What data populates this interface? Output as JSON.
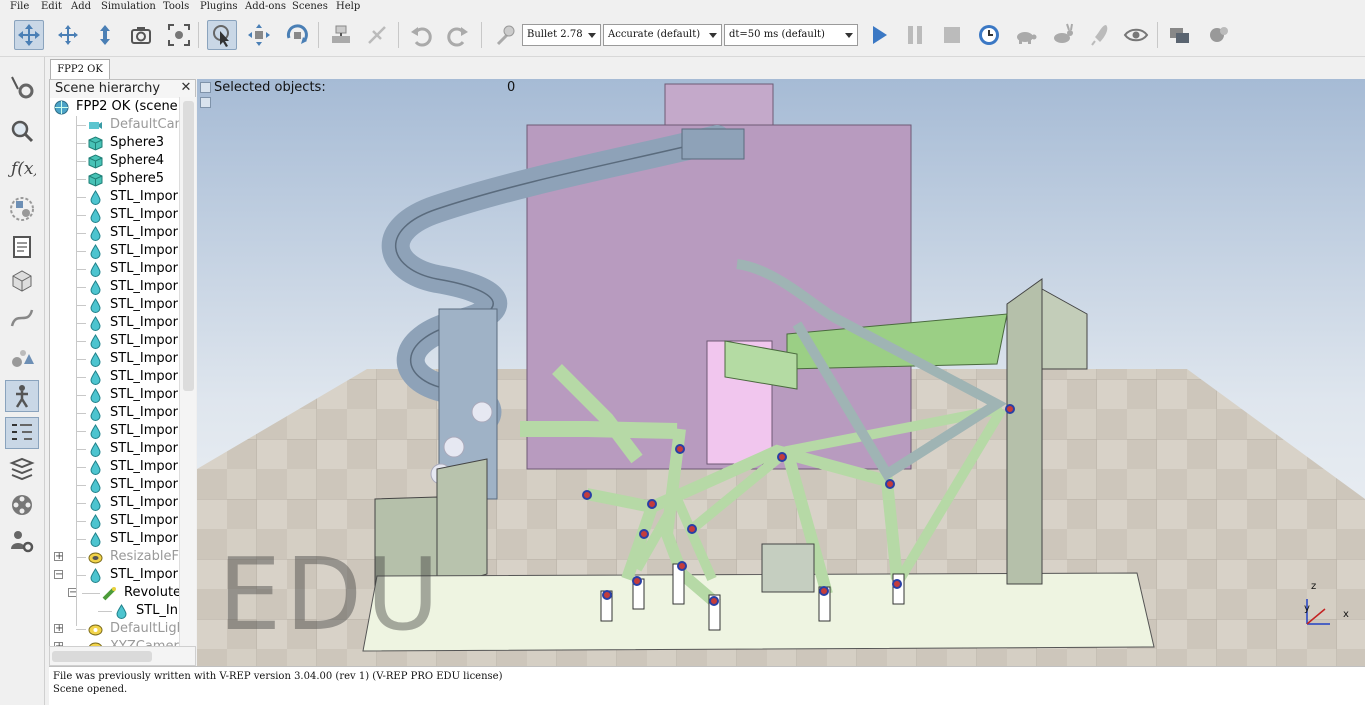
{
  "menu": [
    "File",
    "Edit",
    "Add",
    "Simulation",
    "Tools",
    "Plugins",
    "Add-ons",
    "Scenes",
    "Help"
  ],
  "toolbar": {
    "engine": "Bullet 2.78",
    "accuracy": "Accurate (default)",
    "timestep": "dt=50 ms (default)"
  },
  "tab": {
    "label": "FPP2 OK"
  },
  "hierarchy": {
    "title": "Scene hierarchy",
    "close": "✕",
    "rows": [
      {
        "label": "FPP2 OK (scene 1"
      },
      {
        "label": "DefaultCam"
      },
      {
        "label": "Sphere3"
      },
      {
        "label": "Sphere4"
      },
      {
        "label": "Sphere5"
      },
      {
        "label": "STL_Impor"
      },
      {
        "label": "STL_Impor"
      },
      {
        "label": "STL_Impor"
      },
      {
        "label": "STL_Impor"
      },
      {
        "label": "STL_Impor"
      },
      {
        "label": "STL_Impor"
      },
      {
        "label": "STL_Impor"
      },
      {
        "label": "STL_Impor"
      },
      {
        "label": "STL_Impor"
      },
      {
        "label": "STL_Impor"
      },
      {
        "label": "STL_Impor"
      },
      {
        "label": "STL_Impor"
      },
      {
        "label": "STL_Impor"
      },
      {
        "label": "STL_Impor"
      },
      {
        "label": "STL_Impor"
      },
      {
        "label": "STL_Impor"
      },
      {
        "label": "STL_Impor"
      },
      {
        "label": "STL_Impor"
      },
      {
        "label": "STL_Impor"
      },
      {
        "label": "STL_Impor"
      },
      {
        "label": "ResizableF"
      },
      {
        "label": "STL_Impor"
      },
      {
        "label": "Revolute"
      },
      {
        "label": "STL_In"
      },
      {
        "label": "DefaultLigh"
      },
      {
        "label": "XYZCamer"
      }
    ]
  },
  "viewport": {
    "selected_label": "Selected objects:",
    "selected_count": "0",
    "watermark": "EDU",
    "axes": {
      "x": "x",
      "y": "y",
      "z": "z"
    }
  },
  "console": {
    "lines": [
      "File was previously written with V-REP version 3.04.00 (rev 1) (V-REP PRO EDU license)",
      "Scene opened."
    ]
  },
  "colors": {
    "sky_top": "#a9bdd6",
    "sky_bottom": "#eef2f5",
    "floor": "#c9c3b8",
    "pink_wall": "#b79cbf",
    "green_part": "#b8d9a8",
    "spiral": "#8fa3b8",
    "post": "#b7c2ad"
  }
}
